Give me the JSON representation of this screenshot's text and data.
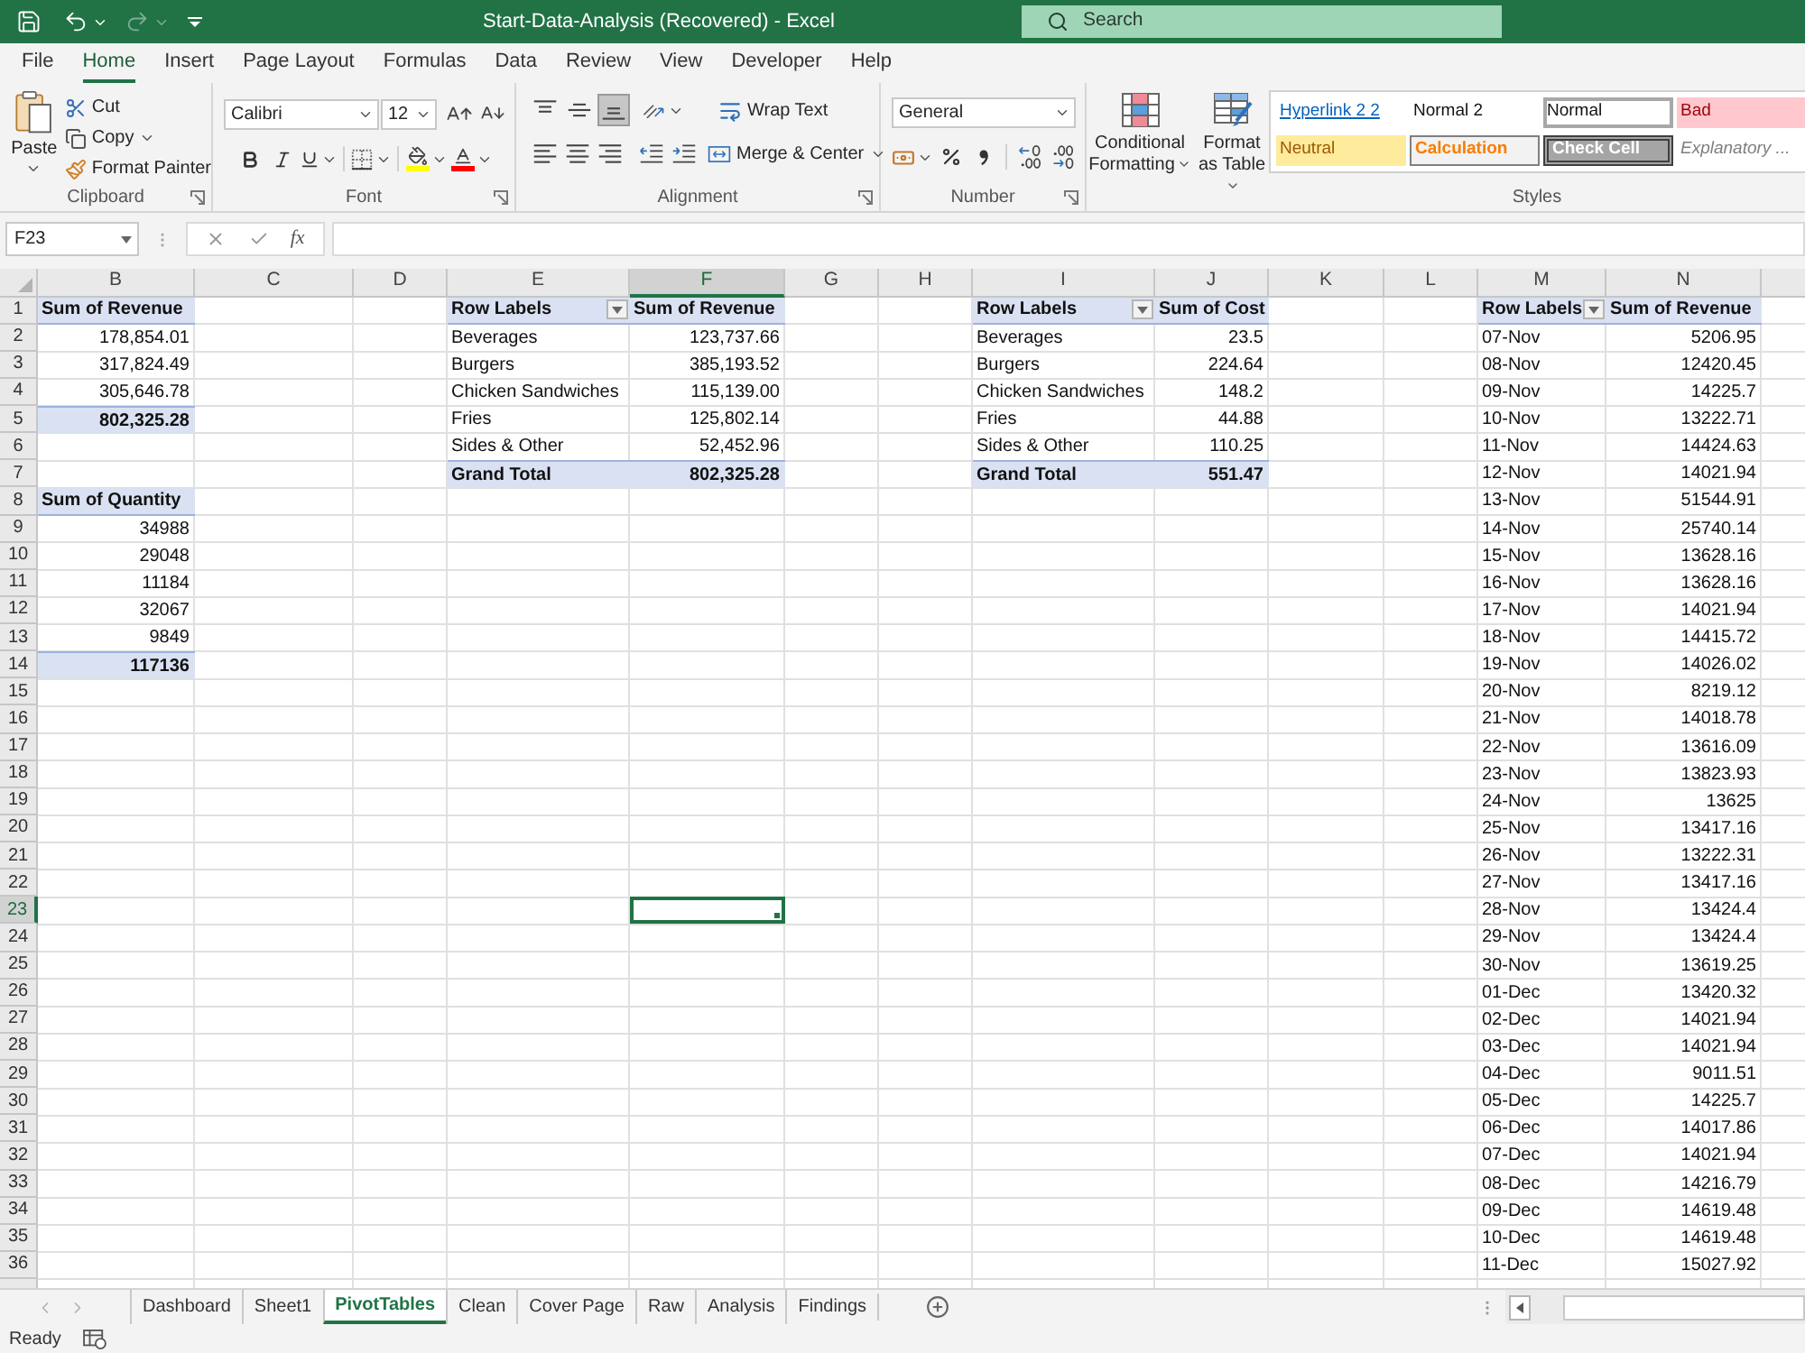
{
  "title_bar": {
    "title": "Start-Data-Analysis (Recovered) - Excel",
    "redo": {
      "disabled": true
    },
    "search": {
      "placeholder": "Search"
    }
  },
  "ribbon_tabs": [
    {
      "label": "File",
      "selected": false
    },
    {
      "label": "Home",
      "selected": true
    },
    {
      "label": "Insert",
      "selected": false
    },
    {
      "label": "Page Layout",
      "selected": false
    },
    {
      "label": "Formulas",
      "selected": false
    },
    {
      "label": "Data",
      "selected": false
    },
    {
      "label": "Review",
      "selected": false
    },
    {
      "label": "View",
      "selected": false
    },
    {
      "label": "Developer",
      "selected": false
    },
    {
      "label": "Help",
      "selected": false
    }
  ],
  "ribbon": {
    "clipboard": {
      "paste": "Paste",
      "cut": "Cut",
      "copy": "Copy",
      "format_painter": "Format Painter",
      "label": "Clipboard"
    },
    "font": {
      "font_name": "Calibri",
      "font_size": "12",
      "label": "Font"
    },
    "alignment": {
      "vertical": [
        {
          "kind": "top",
          "selected": false
        },
        {
          "kind": "middle",
          "selected": false
        },
        {
          "kind": "bottom",
          "selected": true
        }
      ],
      "wrap_text": "Wrap Text",
      "merge_center": "Merge & Center",
      "label": "Alignment"
    },
    "number": {
      "format": "General",
      "label": "Number"
    },
    "tables": {
      "conditional_formatting": "Conditional Formatting",
      "format_as_table": "Format as Table"
    },
    "styles": {
      "gallery": [
        {
          "label": "Hyperlink 2 2",
          "kind": "hyperlink",
          "selected": false
        },
        {
          "label": "Normal 2",
          "kind": "plain",
          "selected": false
        },
        {
          "label": "Normal",
          "kind": "plain",
          "selected": true
        },
        {
          "label": "Bad",
          "kind": "bad",
          "selected": false
        },
        {
          "label": "Neutral",
          "kind": "neutral",
          "selected": false
        },
        {
          "label": "Calculation",
          "kind": "calculation",
          "selected": false
        },
        {
          "label": "Check Cell",
          "kind": "check",
          "selected": false
        },
        {
          "label": "Explanatory ...",
          "kind": "explanatory",
          "selected": false
        }
      ],
      "label": "Styles"
    }
  },
  "formula_bar": {
    "name_box": "F23",
    "function_label": "fx"
  },
  "sheet": {
    "columns": [
      {
        "label": "B",
        "selected": false
      },
      {
        "label": "C",
        "selected": false
      },
      {
        "label": "D",
        "selected": false
      },
      {
        "label": "E",
        "selected": false
      },
      {
        "label": "F",
        "selected": true
      },
      {
        "label": "G",
        "selected": false
      },
      {
        "label": "H",
        "selected": false
      },
      {
        "label": "I",
        "selected": false
      },
      {
        "label": "J",
        "selected": false
      },
      {
        "label": "K",
        "selected": false
      },
      {
        "label": "L",
        "selected": false
      },
      {
        "label": "M",
        "selected": false
      },
      {
        "label": "N",
        "selected": false
      }
    ],
    "rows": [
      {
        "label": "1",
        "selected": false,
        "cells": [
          {
            "text": "Sum of Revenue",
            "kind": "header"
          },
          null,
          null,
          {
            "text": "Row Labels",
            "kind": "header_filter"
          },
          {
            "text": "Sum of Revenue",
            "kind": "header"
          },
          null,
          null,
          {
            "text": "Row Labels",
            "kind": "header_filter"
          },
          {
            "text": "Sum of Cost",
            "kind": "header"
          },
          null,
          null,
          {
            "text": "Row Labels",
            "kind": "header_filter"
          },
          {
            "text": "Sum of Revenue",
            "kind": "header"
          }
        ]
      },
      {
        "label": "2",
        "selected": false,
        "cells": [
          {
            "text": "178,854.01",
            "kind": "value"
          },
          null,
          null,
          {
            "text": "Beverages",
            "kind": "label"
          },
          {
            "text": "123,737.66",
            "kind": "value"
          },
          null,
          null,
          {
            "text": "Beverages",
            "kind": "label"
          },
          {
            "text": "23.5",
            "kind": "value"
          },
          null,
          null,
          {
            "text": "07-Nov",
            "kind": "label"
          },
          {
            "text": "5206.95",
            "kind": "value"
          }
        ]
      },
      {
        "label": "3",
        "selected": false,
        "cells": [
          {
            "text": "317,824.49",
            "kind": "value"
          },
          null,
          null,
          {
            "text": "Burgers",
            "kind": "label"
          },
          {
            "text": "385,193.52",
            "kind": "value"
          },
          null,
          null,
          {
            "text": "Burgers",
            "kind": "label"
          },
          {
            "text": "224.64",
            "kind": "value"
          },
          null,
          null,
          {
            "text": "08-Nov",
            "kind": "label"
          },
          {
            "text": "12420.45",
            "kind": "value"
          }
        ]
      },
      {
        "label": "4",
        "selected": false,
        "cells": [
          {
            "text": "305,646.78",
            "kind": "value"
          },
          null,
          null,
          {
            "text": "Chicken Sandwiches",
            "kind": "label"
          },
          {
            "text": "115,139.00",
            "kind": "value"
          },
          null,
          null,
          {
            "text": "Chicken Sandwiches",
            "kind": "label"
          },
          {
            "text": "148.2",
            "kind": "value"
          },
          null,
          null,
          {
            "text": "09-Nov",
            "kind": "label"
          },
          {
            "text": "14225.7",
            "kind": "value"
          }
        ]
      },
      {
        "label": "5",
        "selected": false,
        "cells": [
          {
            "text": "802,325.28",
            "kind": "total_value"
          },
          null,
          null,
          {
            "text": "Fries",
            "kind": "label"
          },
          {
            "text": "125,802.14",
            "kind": "value"
          },
          null,
          null,
          {
            "text": "Fries",
            "kind": "label"
          },
          {
            "text": "44.88",
            "kind": "value"
          },
          null,
          null,
          {
            "text": "10-Nov",
            "kind": "label"
          },
          {
            "text": "13222.71",
            "kind": "value"
          }
        ]
      },
      {
        "label": "6",
        "selected": false,
        "cells": [
          null,
          null,
          null,
          {
            "text": "Sides & Other",
            "kind": "label"
          },
          {
            "text": "52,452.96",
            "kind": "value"
          },
          null,
          null,
          {
            "text": "Sides & Other",
            "kind": "label"
          },
          {
            "text": "110.25",
            "kind": "value"
          },
          null,
          null,
          {
            "text": "11-Nov",
            "kind": "label"
          },
          {
            "text": "14424.63",
            "kind": "value"
          }
        ]
      },
      {
        "label": "7",
        "selected": false,
        "cells": [
          null,
          null,
          null,
          {
            "text": "Grand Total",
            "kind": "total_label"
          },
          {
            "text": "802,325.28",
            "kind": "total_value"
          },
          null,
          null,
          {
            "text": "Grand Total",
            "kind": "total_label"
          },
          {
            "text": "551.47",
            "kind": "total_value"
          },
          null,
          null,
          {
            "text": "12-Nov",
            "kind": "label"
          },
          {
            "text": "14021.94",
            "kind": "value"
          }
        ]
      },
      {
        "label": "8",
        "selected": false,
        "cells": [
          {
            "text": "Sum of Quantity",
            "kind": "header"
          },
          null,
          null,
          null,
          null,
          null,
          null,
          null,
          null,
          null,
          null,
          {
            "text": "13-Nov",
            "kind": "label"
          },
          {
            "text": "51544.91",
            "kind": "value"
          }
        ]
      },
      {
        "label": "9",
        "selected": false,
        "cells": [
          {
            "text": "34988",
            "kind": "value"
          },
          null,
          null,
          null,
          null,
          null,
          null,
          null,
          null,
          null,
          null,
          {
            "text": "14-Nov",
            "kind": "label"
          },
          {
            "text": "25740.14",
            "kind": "value"
          }
        ]
      },
      {
        "label": "10",
        "selected": false,
        "cells": [
          {
            "text": "29048",
            "kind": "value"
          },
          null,
          null,
          null,
          null,
          null,
          null,
          null,
          null,
          null,
          null,
          {
            "text": "15-Nov",
            "kind": "label"
          },
          {
            "text": "13628.16",
            "kind": "value"
          }
        ]
      },
      {
        "label": "11",
        "selected": false,
        "cells": [
          {
            "text": "11184",
            "kind": "value"
          },
          null,
          null,
          null,
          null,
          null,
          null,
          null,
          null,
          null,
          null,
          {
            "text": "16-Nov",
            "kind": "label"
          },
          {
            "text": "13628.16",
            "kind": "value"
          }
        ]
      },
      {
        "label": "12",
        "selected": false,
        "cells": [
          {
            "text": "32067",
            "kind": "value"
          },
          null,
          null,
          null,
          null,
          null,
          null,
          null,
          null,
          null,
          null,
          {
            "text": "17-Nov",
            "kind": "label"
          },
          {
            "text": "14021.94",
            "kind": "value"
          }
        ]
      },
      {
        "label": "13",
        "selected": false,
        "cells": [
          {
            "text": "9849",
            "kind": "value"
          },
          null,
          null,
          null,
          null,
          null,
          null,
          null,
          null,
          null,
          null,
          {
            "text": "18-Nov",
            "kind": "label"
          },
          {
            "text": "14415.72",
            "kind": "value"
          }
        ]
      },
      {
        "label": "14",
        "selected": false,
        "cells": [
          {
            "text": "117136",
            "kind": "total_value"
          },
          null,
          null,
          null,
          null,
          null,
          null,
          null,
          null,
          null,
          null,
          {
            "text": "19-Nov",
            "kind": "label"
          },
          {
            "text": "14026.02",
            "kind": "value"
          }
        ]
      },
      {
        "label": "15",
        "selected": false,
        "cells": [
          null,
          null,
          null,
          null,
          null,
          null,
          null,
          null,
          null,
          null,
          null,
          {
            "text": "20-Nov",
            "kind": "label"
          },
          {
            "text": "8219.12",
            "kind": "value"
          }
        ]
      },
      {
        "label": "16",
        "selected": false,
        "cells": [
          null,
          null,
          null,
          null,
          null,
          null,
          null,
          null,
          null,
          null,
          null,
          {
            "text": "21-Nov",
            "kind": "label"
          },
          {
            "text": "14018.78",
            "kind": "value"
          }
        ]
      },
      {
        "label": "17",
        "selected": false,
        "cells": [
          null,
          null,
          null,
          null,
          null,
          null,
          null,
          null,
          null,
          null,
          null,
          {
            "text": "22-Nov",
            "kind": "label"
          },
          {
            "text": "13616.09",
            "kind": "value"
          }
        ]
      },
      {
        "label": "18",
        "selected": false,
        "cells": [
          null,
          null,
          null,
          null,
          null,
          null,
          null,
          null,
          null,
          null,
          null,
          {
            "text": "23-Nov",
            "kind": "label"
          },
          {
            "text": "13823.93",
            "kind": "value"
          }
        ]
      },
      {
        "label": "19",
        "selected": false,
        "cells": [
          null,
          null,
          null,
          null,
          null,
          null,
          null,
          null,
          null,
          null,
          null,
          {
            "text": "24-Nov",
            "kind": "label"
          },
          {
            "text": "13625",
            "kind": "value"
          }
        ]
      },
      {
        "label": "20",
        "selected": false,
        "cells": [
          null,
          null,
          null,
          null,
          null,
          null,
          null,
          null,
          null,
          null,
          null,
          {
            "text": "25-Nov",
            "kind": "label"
          },
          {
            "text": "13417.16",
            "kind": "value"
          }
        ]
      },
      {
        "label": "21",
        "selected": false,
        "cells": [
          null,
          null,
          null,
          null,
          null,
          null,
          null,
          null,
          null,
          null,
          null,
          {
            "text": "26-Nov",
            "kind": "label"
          },
          {
            "text": "13222.31",
            "kind": "value"
          }
        ]
      },
      {
        "label": "22",
        "selected": false,
        "cells": [
          null,
          null,
          null,
          null,
          null,
          null,
          null,
          null,
          null,
          null,
          null,
          {
            "text": "27-Nov",
            "kind": "label"
          },
          {
            "text": "13417.16",
            "kind": "value"
          }
        ]
      },
      {
        "label": "23",
        "selected": true,
        "cells": [
          null,
          null,
          null,
          null,
          null,
          null,
          null,
          null,
          null,
          null,
          null,
          {
            "text": "28-Nov",
            "kind": "label"
          },
          {
            "text": "13424.4",
            "kind": "value"
          }
        ]
      },
      {
        "label": "24",
        "selected": false,
        "cells": [
          null,
          null,
          null,
          null,
          null,
          null,
          null,
          null,
          null,
          null,
          null,
          {
            "text": "29-Nov",
            "kind": "label"
          },
          {
            "text": "13424.4",
            "kind": "value"
          }
        ]
      },
      {
        "label": "25",
        "selected": false,
        "cells": [
          null,
          null,
          null,
          null,
          null,
          null,
          null,
          null,
          null,
          null,
          null,
          {
            "text": "30-Nov",
            "kind": "label"
          },
          {
            "text": "13619.25",
            "kind": "value"
          }
        ]
      },
      {
        "label": "26",
        "selected": false,
        "cells": [
          null,
          null,
          null,
          null,
          null,
          null,
          null,
          null,
          null,
          null,
          null,
          {
            "text": "01-Dec",
            "kind": "label"
          },
          {
            "text": "13420.32",
            "kind": "value"
          }
        ]
      },
      {
        "label": "27",
        "selected": false,
        "cells": [
          null,
          null,
          null,
          null,
          null,
          null,
          null,
          null,
          null,
          null,
          null,
          {
            "text": "02-Dec",
            "kind": "label"
          },
          {
            "text": "14021.94",
            "kind": "value"
          }
        ]
      },
      {
        "label": "28",
        "selected": false,
        "cells": [
          null,
          null,
          null,
          null,
          null,
          null,
          null,
          null,
          null,
          null,
          null,
          {
            "text": "03-Dec",
            "kind": "label"
          },
          {
            "text": "14021.94",
            "kind": "value"
          }
        ]
      },
      {
        "label": "29",
        "selected": false,
        "cells": [
          null,
          null,
          null,
          null,
          null,
          null,
          null,
          null,
          null,
          null,
          null,
          {
            "text": "04-Dec",
            "kind": "label"
          },
          {
            "text": "9011.51",
            "kind": "value"
          }
        ]
      },
      {
        "label": "30",
        "selected": false,
        "cells": [
          null,
          null,
          null,
          null,
          null,
          null,
          null,
          null,
          null,
          null,
          null,
          {
            "text": "05-Dec",
            "kind": "label"
          },
          {
            "text": "14225.7",
            "kind": "value"
          }
        ]
      },
      {
        "label": "31",
        "selected": false,
        "cells": [
          null,
          null,
          null,
          null,
          null,
          null,
          null,
          null,
          null,
          null,
          null,
          {
            "text": "06-Dec",
            "kind": "label"
          },
          {
            "text": "14017.86",
            "kind": "value"
          }
        ]
      },
      {
        "label": "32",
        "selected": false,
        "cells": [
          null,
          null,
          null,
          null,
          null,
          null,
          null,
          null,
          null,
          null,
          null,
          {
            "text": "07-Dec",
            "kind": "label"
          },
          {
            "text": "14021.94",
            "kind": "value"
          }
        ]
      },
      {
        "label": "33",
        "selected": false,
        "cells": [
          null,
          null,
          null,
          null,
          null,
          null,
          null,
          null,
          null,
          null,
          null,
          {
            "text": "08-Dec",
            "kind": "label"
          },
          {
            "text": "14216.79",
            "kind": "value"
          }
        ]
      },
      {
        "label": "34",
        "selected": false,
        "cells": [
          null,
          null,
          null,
          null,
          null,
          null,
          null,
          null,
          null,
          null,
          null,
          {
            "text": "09-Dec",
            "kind": "label"
          },
          {
            "text": "14619.48",
            "kind": "value"
          }
        ]
      },
      {
        "label": "35",
        "selected": false,
        "cells": [
          null,
          null,
          null,
          null,
          null,
          null,
          null,
          null,
          null,
          null,
          null,
          {
            "text": "10-Dec",
            "kind": "label"
          },
          {
            "text": "14619.48",
            "kind": "value"
          }
        ]
      },
      {
        "label": "36",
        "selected": false,
        "cells": [
          null,
          null,
          null,
          null,
          null,
          null,
          null,
          null,
          null,
          null,
          null,
          {
            "text": "11-Dec",
            "kind": "label"
          },
          {
            "text": "15027.92",
            "kind": "value"
          }
        ]
      }
    ]
  },
  "sheet_tabs": [
    {
      "label": "Dashboard",
      "selected": false
    },
    {
      "label": "Sheet1",
      "selected": false
    },
    {
      "label": "PivotTables",
      "selected": true
    },
    {
      "label": "Clean",
      "selected": false
    },
    {
      "label": "Cover Page",
      "selected": false
    },
    {
      "label": "Raw",
      "selected": false
    },
    {
      "label": "Analysis",
      "selected": false
    },
    {
      "label": "Findings",
      "selected": false
    }
  ],
  "status_bar": {
    "mode": "Ready"
  }
}
